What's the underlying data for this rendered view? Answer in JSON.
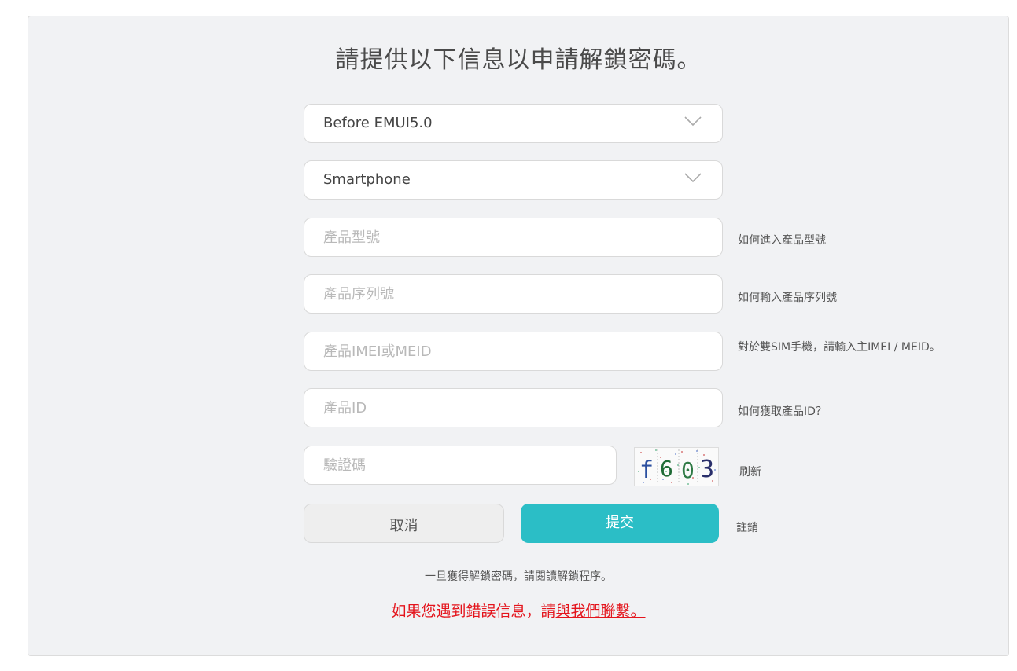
{
  "title": "請提供以下信息以申請解鎖密碼。",
  "version_select": {
    "value": "Before EMUI5.0"
  },
  "device_select": {
    "value": "Smartphone"
  },
  "model": {
    "placeholder": "產品型號",
    "hint": "如何進入產品型號"
  },
  "serial": {
    "placeholder": "產品序列號",
    "hint": "如何輸入產品序列號"
  },
  "imei": {
    "placeholder": "產品IMEI或MEID",
    "hint": "對於雙SIM手機，請輸入主IMEI / MEID。"
  },
  "product_id": {
    "placeholder": "產品ID",
    "hint": "如何獲取產品ID？"
  },
  "captcha": {
    "placeholder": "驗證碼",
    "image_text": "f603",
    "refresh": "刷新"
  },
  "buttons": {
    "cancel": "取消",
    "submit": "提交",
    "logout": "註銷"
  },
  "note": "一旦獲得解鎖密碼，請閱讀解鎖程序。",
  "error": {
    "text": "如果您遇到錯誤信息，請",
    "link": "與我們聯繫。"
  },
  "colors": {
    "accent": "#2bbec6",
    "error": "#e4141c",
    "panel": "#f1f2f4"
  }
}
